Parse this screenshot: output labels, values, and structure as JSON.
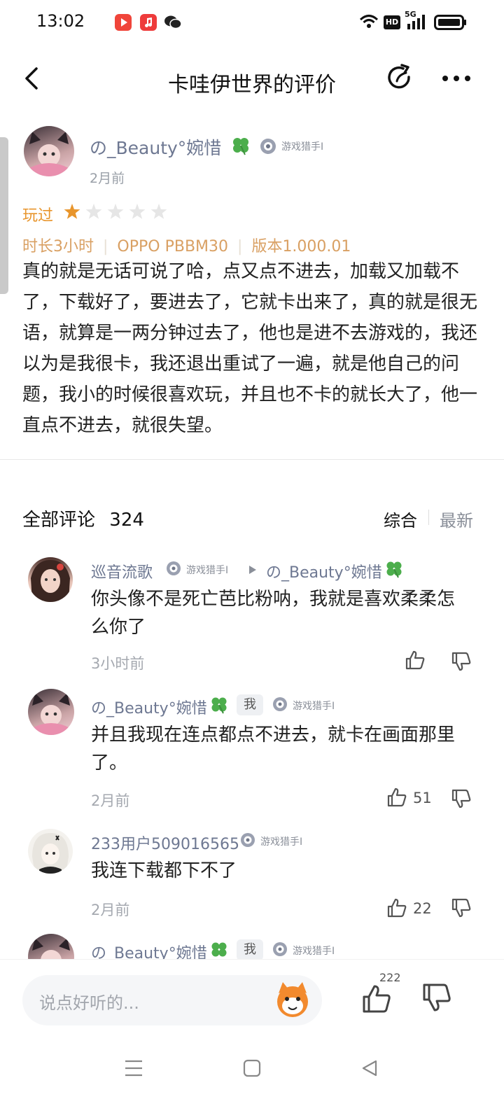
{
  "status_bar": {
    "time": "13:02",
    "network": "5G",
    "hd": "HD"
  },
  "header": {
    "title": "卡哇伊世界的评价"
  },
  "review": {
    "author": "の_Beauty°婉惜",
    "badge": "游戏猎手Ⅰ",
    "time": "2月前",
    "played_label": "玩过",
    "rating": 1,
    "rating_max": 5,
    "playtime": "时长3小时",
    "device": "OPPO PBBM30",
    "version": "版本1.000.01",
    "body": "真的就是无话可说了哈，点又点不进去，加载又加载不了，下载好了，要进去了，它就卡出来了，真的就是很无语，就算是一两分钟过去了，他也是进不去游戏的，我还以为是我很卡，我还退出重试了一遍，就是他自己的问题，我小的时候很喜欢玩，并且也不卡的就长大了，他一直点不进去，就很失望。"
  },
  "comments_header": {
    "label": "全部评论",
    "count": "324",
    "sort_default": "综合",
    "sort_latest": "最新"
  },
  "comments": [
    {
      "author": "巡音流歌",
      "badge": "游戏猎手Ⅰ",
      "reply_to": "の_Beauty°婉惜",
      "text": "你头像不是死亡芭比粉呐，我就是喜欢柔柔怎么你了",
      "time": "3小时前",
      "likes": ""
    },
    {
      "author": "の_Beauty°婉惜",
      "me_tag": "我",
      "badge": "游戏猎手Ⅰ",
      "text": "并且我现在连点都点不进去，就卡在画面那里了。",
      "time": "2月前",
      "likes": "51"
    },
    {
      "author": "233用户509016565",
      "badge": "游戏猎手Ⅰ",
      "text": "我连下载都下不了",
      "time": "2月前",
      "likes": "22"
    },
    {
      "author": "の_Beauty°婉惜",
      "me_tag": "我",
      "badge": "游戏猎手Ⅰ"
    }
  ],
  "bottom_bar": {
    "input_placeholder": "说点好听的...",
    "like_count": "222"
  },
  "colors": {
    "accent_orange": "#e8952c",
    "username": "#6e7892"
  }
}
